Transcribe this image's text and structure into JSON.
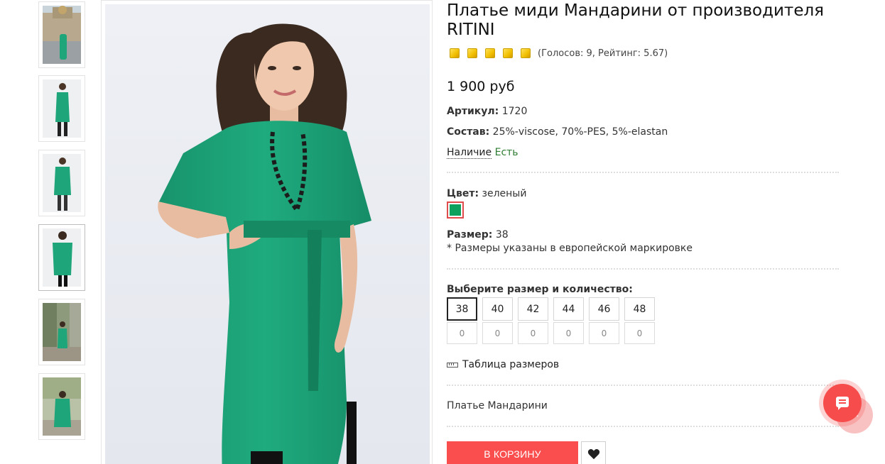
{
  "product": {
    "title": "Платье миди Мандарини от производителя RITINI",
    "rating": {
      "stars": 5,
      "text": "(Голосов: 9, Рейтинг: 5.67)"
    },
    "price": "1 900 руб",
    "article": {
      "label": "Артикул:",
      "value": "1720"
    },
    "composition": {
      "label": "Состав:",
      "value": "25%-viscose, 70%-PES, 5%-elastan"
    },
    "availability": {
      "label": "Наличие",
      "value": "Есть"
    },
    "color": {
      "label": "Цвет:",
      "value": "зеленый",
      "swatch": "#0ca15c"
    },
    "size": {
      "label": "Размер:",
      "value": "38",
      "note": "* Размеры указаны в европейской маркировке"
    },
    "size_picker": {
      "label": "Выберите размер и количество:",
      "sizes": [
        "38",
        "40",
        "42",
        "44",
        "46",
        "48"
      ],
      "quantities": [
        "0",
        "0",
        "0",
        "0",
        "0",
        "0"
      ],
      "selected": "38"
    },
    "size_table_label": "Таблица размеров",
    "short_name": "Платье Мандарини",
    "add_to_cart_label": "В КОРЗИНУ"
  },
  "colors": {
    "accent": "#fa4e4e",
    "dress": "#1ea57a",
    "stock": "#2e7d32"
  },
  "icons": {
    "ruler": "ruler-icon",
    "favorite": "heart-icon",
    "chat": "chat-icon",
    "scroll_up": "chevron-up-icon"
  }
}
